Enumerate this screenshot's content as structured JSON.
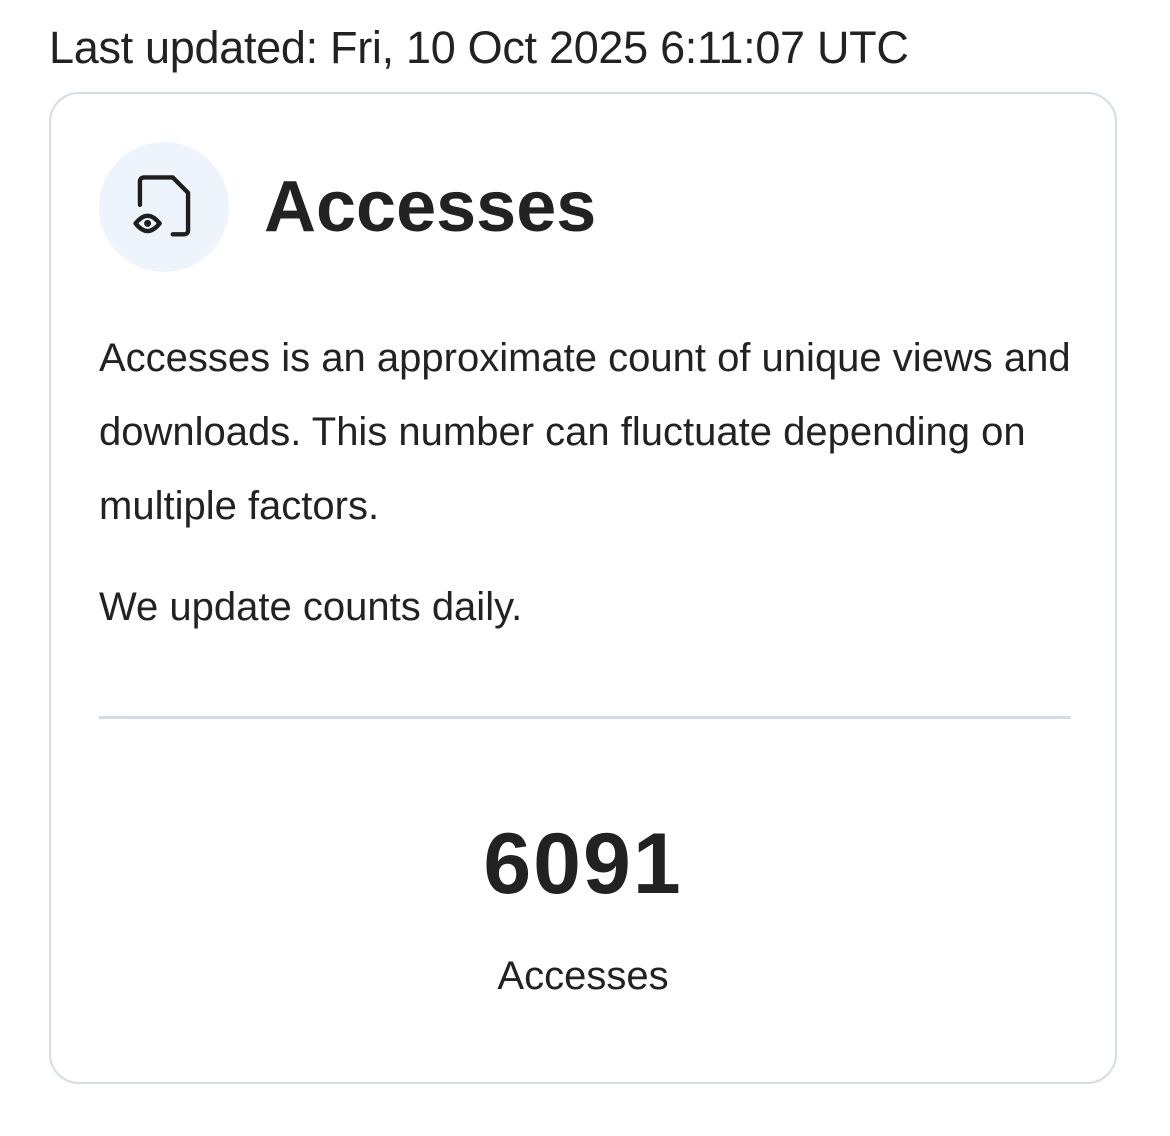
{
  "last_updated": "Last updated: Fri, 10 Oct 2025 6:11:07 UTC",
  "card": {
    "icon": "file-eye-icon",
    "title": "Accesses",
    "description": "Accesses is an approximate count of unique views and downloads. This number can fluctuate depending on multiple factors.",
    "update_note": "We update counts daily.",
    "count": "6091",
    "count_label": "Accesses"
  },
  "colors": {
    "text": "#222222",
    "border": "#d3dde6",
    "icon_bg": "#edf4fc"
  }
}
